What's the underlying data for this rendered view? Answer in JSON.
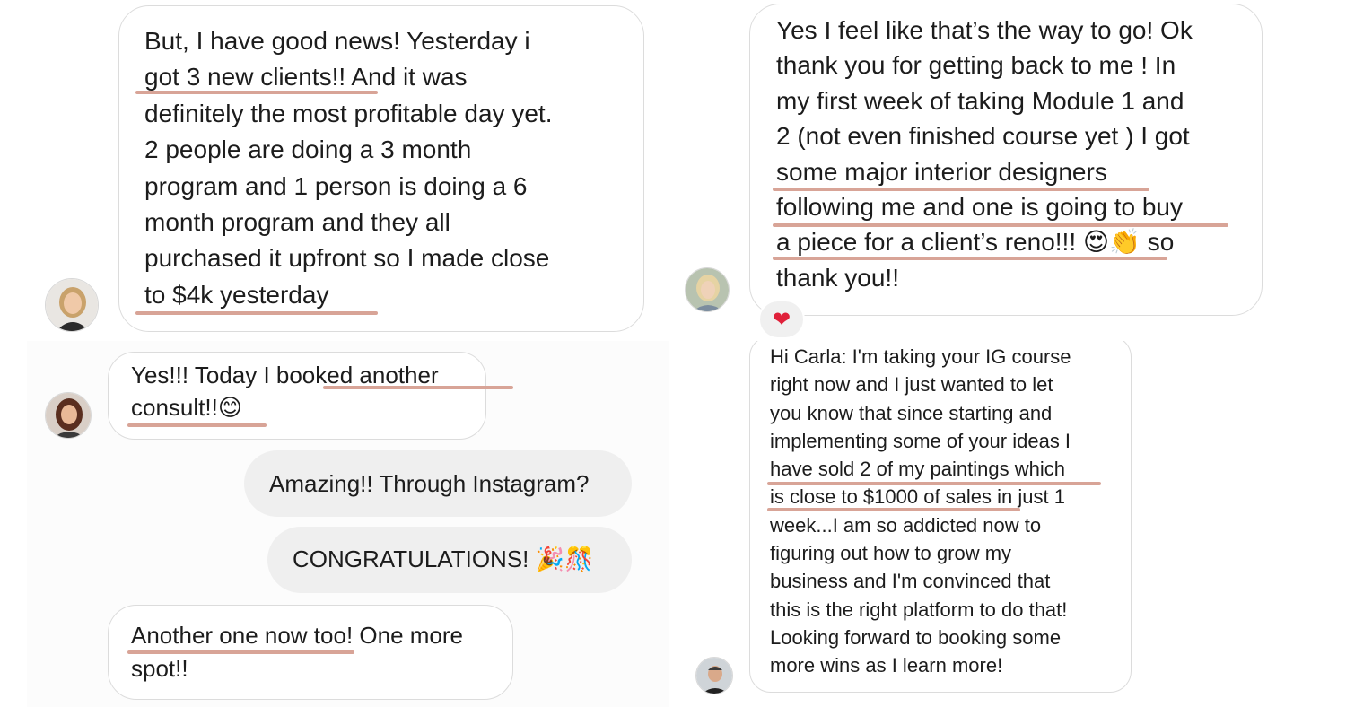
{
  "accent_underline": "#d8a497",
  "panels": {
    "top_left": {
      "lines": [
        "But, I have good news! Yesterday i",
        "got 3 new clients!! And it was",
        "definitely the most profitable day yet.",
        "2 people are doing a 3 month",
        "program and 1 person is doing a 6",
        "month program and they all",
        "purchased it upfront so I made close",
        "to $4k yesterday"
      ],
      "avatar_icon": "avatar-woman-blonde"
    },
    "top_right": {
      "lines": [
        "Yes I feel like that’s the way to go! Ok",
        "thank you for getting back to me ! In",
        "my first week of taking Module 1 and",
        "2 (not even finished course yet ) I got",
        "some major interior designers",
        "following me and one is going to buy",
        "a piece for a client’s reno!!!",
        "so",
        "thank you!!"
      ],
      "emojis": [
        "😍",
        "👏"
      ],
      "reaction": "❤",
      "avatar_icon": "avatar-woman-light-hair"
    },
    "bottom_left": {
      "msg1_lines": [
        "Yes!!! Today I booked another",
        "consult!!"
      ],
      "msg1_emoji": "😊",
      "sent1": "Amazing!! Through Instagram?",
      "sent2": "CONGRATULATIONS!",
      "sent2_emojis": "🎉🎊",
      "msg2_lines": [
        "Another one now too! One more",
        "spot!!"
      ],
      "avatar_icon": "avatar-woman-dark-hair"
    },
    "bottom_right": {
      "lines": [
        "Hi Carla: I'm taking your IG course",
        "right now and I just wanted to let",
        "you know that since starting and",
        "implementing some of your ideas I",
        "have sold 2 of my paintings which",
        "is close to $1000 of sales in just 1",
        "week...I am so addicted now to",
        "figuring out how to grow my",
        "business and I'm convinced that",
        "this is the right platform to do that!",
        "Looking forward to booking some",
        "more wins as I learn more!"
      ],
      "avatar_icon": "avatar-man"
    }
  }
}
